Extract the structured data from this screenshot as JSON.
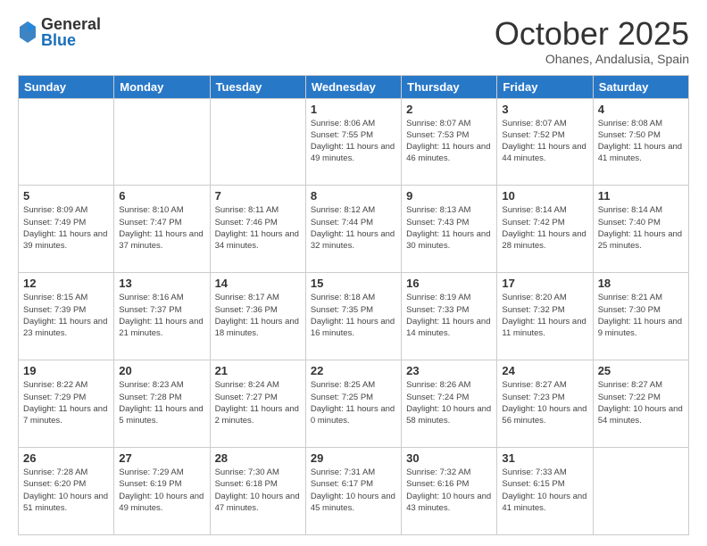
{
  "header": {
    "logo_general": "General",
    "logo_blue": "Blue",
    "month_title": "October 2025",
    "location": "Ohanes, Andalusia, Spain"
  },
  "days_of_week": [
    "Sunday",
    "Monday",
    "Tuesday",
    "Wednesday",
    "Thursday",
    "Friday",
    "Saturday"
  ],
  "weeks": [
    [
      {
        "day": "",
        "info": ""
      },
      {
        "day": "",
        "info": ""
      },
      {
        "day": "",
        "info": ""
      },
      {
        "day": "1",
        "info": "Sunrise: 8:06 AM\nSunset: 7:55 PM\nDaylight: 11 hours and 49 minutes."
      },
      {
        "day": "2",
        "info": "Sunrise: 8:07 AM\nSunset: 7:53 PM\nDaylight: 11 hours and 46 minutes."
      },
      {
        "day": "3",
        "info": "Sunrise: 8:07 AM\nSunset: 7:52 PM\nDaylight: 11 hours and 44 minutes."
      },
      {
        "day": "4",
        "info": "Sunrise: 8:08 AM\nSunset: 7:50 PM\nDaylight: 11 hours and 41 minutes."
      }
    ],
    [
      {
        "day": "5",
        "info": "Sunrise: 8:09 AM\nSunset: 7:49 PM\nDaylight: 11 hours and 39 minutes."
      },
      {
        "day": "6",
        "info": "Sunrise: 8:10 AM\nSunset: 7:47 PM\nDaylight: 11 hours and 37 minutes."
      },
      {
        "day": "7",
        "info": "Sunrise: 8:11 AM\nSunset: 7:46 PM\nDaylight: 11 hours and 34 minutes."
      },
      {
        "day": "8",
        "info": "Sunrise: 8:12 AM\nSunset: 7:44 PM\nDaylight: 11 hours and 32 minutes."
      },
      {
        "day": "9",
        "info": "Sunrise: 8:13 AM\nSunset: 7:43 PM\nDaylight: 11 hours and 30 minutes."
      },
      {
        "day": "10",
        "info": "Sunrise: 8:14 AM\nSunset: 7:42 PM\nDaylight: 11 hours and 28 minutes."
      },
      {
        "day": "11",
        "info": "Sunrise: 8:14 AM\nSunset: 7:40 PM\nDaylight: 11 hours and 25 minutes."
      }
    ],
    [
      {
        "day": "12",
        "info": "Sunrise: 8:15 AM\nSunset: 7:39 PM\nDaylight: 11 hours and 23 minutes."
      },
      {
        "day": "13",
        "info": "Sunrise: 8:16 AM\nSunset: 7:37 PM\nDaylight: 11 hours and 21 minutes."
      },
      {
        "day": "14",
        "info": "Sunrise: 8:17 AM\nSunset: 7:36 PM\nDaylight: 11 hours and 18 minutes."
      },
      {
        "day": "15",
        "info": "Sunrise: 8:18 AM\nSunset: 7:35 PM\nDaylight: 11 hours and 16 minutes."
      },
      {
        "day": "16",
        "info": "Sunrise: 8:19 AM\nSunset: 7:33 PM\nDaylight: 11 hours and 14 minutes."
      },
      {
        "day": "17",
        "info": "Sunrise: 8:20 AM\nSunset: 7:32 PM\nDaylight: 11 hours and 11 minutes."
      },
      {
        "day": "18",
        "info": "Sunrise: 8:21 AM\nSunset: 7:30 PM\nDaylight: 11 hours and 9 minutes."
      }
    ],
    [
      {
        "day": "19",
        "info": "Sunrise: 8:22 AM\nSunset: 7:29 PM\nDaylight: 11 hours and 7 minutes."
      },
      {
        "day": "20",
        "info": "Sunrise: 8:23 AM\nSunset: 7:28 PM\nDaylight: 11 hours and 5 minutes."
      },
      {
        "day": "21",
        "info": "Sunrise: 8:24 AM\nSunset: 7:27 PM\nDaylight: 11 hours and 2 minutes."
      },
      {
        "day": "22",
        "info": "Sunrise: 8:25 AM\nSunset: 7:25 PM\nDaylight: 11 hours and 0 minutes."
      },
      {
        "day": "23",
        "info": "Sunrise: 8:26 AM\nSunset: 7:24 PM\nDaylight: 10 hours and 58 minutes."
      },
      {
        "day": "24",
        "info": "Sunrise: 8:27 AM\nSunset: 7:23 PM\nDaylight: 10 hours and 56 minutes."
      },
      {
        "day": "25",
        "info": "Sunrise: 8:27 AM\nSunset: 7:22 PM\nDaylight: 10 hours and 54 minutes."
      }
    ],
    [
      {
        "day": "26",
        "info": "Sunrise: 7:28 AM\nSunset: 6:20 PM\nDaylight: 10 hours and 51 minutes."
      },
      {
        "day": "27",
        "info": "Sunrise: 7:29 AM\nSunset: 6:19 PM\nDaylight: 10 hours and 49 minutes."
      },
      {
        "day": "28",
        "info": "Sunrise: 7:30 AM\nSunset: 6:18 PM\nDaylight: 10 hours and 47 minutes."
      },
      {
        "day": "29",
        "info": "Sunrise: 7:31 AM\nSunset: 6:17 PM\nDaylight: 10 hours and 45 minutes."
      },
      {
        "day": "30",
        "info": "Sunrise: 7:32 AM\nSunset: 6:16 PM\nDaylight: 10 hours and 43 minutes."
      },
      {
        "day": "31",
        "info": "Sunrise: 7:33 AM\nSunset: 6:15 PM\nDaylight: 10 hours and 41 minutes."
      },
      {
        "day": "",
        "info": ""
      }
    ]
  ]
}
